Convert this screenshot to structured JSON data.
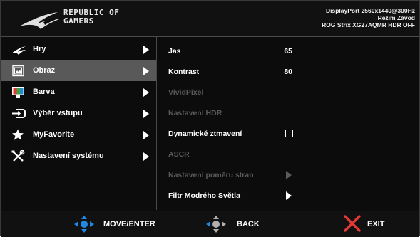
{
  "header": {
    "brand_line1": "REPUBLIC OF",
    "brand_line2": "GAMERS",
    "status_line1": "DisplayPort 2560x1440@300Hz",
    "status_line2": "Režim Závod",
    "status_line3": "ROG Strix XG27AQMR HDR OFF"
  },
  "main_menu": {
    "items": [
      {
        "label": "Hry",
        "icon": "rog-eye-icon"
      },
      {
        "label": "Obraz",
        "icon": "image-icon",
        "selected": true
      },
      {
        "label": "Barva",
        "icon": "color-palette-icon"
      },
      {
        "label": "Výběr vstupu",
        "icon": "input-icon"
      },
      {
        "label": "MyFavorite",
        "icon": "star-icon"
      },
      {
        "label": "Nastavení systému",
        "icon": "tools-icon"
      }
    ]
  },
  "submenu": {
    "items": [
      {
        "label": "Jas",
        "value": "65",
        "enabled": true
      },
      {
        "label": "Kontrast",
        "value": "80",
        "enabled": true
      },
      {
        "label": "VividPixel",
        "enabled": false
      },
      {
        "label": "Nastavení HDR",
        "enabled": false
      },
      {
        "label": "Dynamické ztmavení",
        "enabled": true,
        "checked": false
      },
      {
        "label": "ASCR",
        "enabled": false
      },
      {
        "label": "Nastavení poměru stran",
        "enabled": false
      },
      {
        "label": "Filtr Modrého Světla",
        "enabled": true
      }
    ]
  },
  "footer": {
    "move_label": "MOVE/ENTER",
    "back_label": "BACK",
    "exit_label": "EXIT"
  },
  "colors": {
    "background": "#0c0c0c",
    "selected_row": "#595959",
    "disabled_text": "#5a5a5a",
    "nav_blue": "#1e88e5",
    "exit_red": "#e53935"
  }
}
